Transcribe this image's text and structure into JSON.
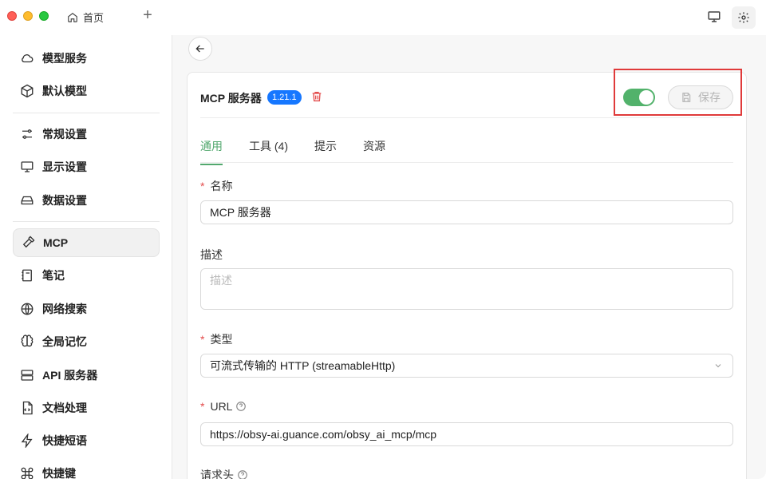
{
  "titlebar": {
    "home_tab": "首页",
    "new_tab": "+"
  },
  "sidebar": {
    "items": [
      {
        "label": "模型服务",
        "icon": "cloud-icon"
      },
      {
        "label": "默认模型",
        "icon": "cube-icon"
      },
      {
        "label": "常规设置",
        "icon": "sliders-icon"
      },
      {
        "label": "显示设置",
        "icon": "display-settings-icon"
      },
      {
        "label": "数据设置",
        "icon": "hard-drive-icon"
      },
      {
        "label": "MCP",
        "icon": "hammer-icon",
        "active": true
      },
      {
        "label": "笔记",
        "icon": "notebook-icon"
      },
      {
        "label": "网络搜索",
        "icon": "globe-icon"
      },
      {
        "label": "全局记忆",
        "icon": "brain-icon"
      },
      {
        "label": "API 服务器",
        "icon": "server-icon"
      },
      {
        "label": "文档处理",
        "icon": "file-code-icon"
      },
      {
        "label": "快捷短语",
        "icon": "zap-icon"
      },
      {
        "label": "快捷键",
        "icon": "command-icon"
      }
    ]
  },
  "server": {
    "title": "MCP 服务器",
    "version": "1.21.1",
    "enabled": true,
    "save_label": "保存"
  },
  "tabs": [
    "通用",
    "工具 (4)",
    "提示",
    "资源"
  ],
  "form": {
    "name_label": "名称",
    "name_value": "MCP 服务器",
    "desc_label": "描述",
    "desc_placeholder": "描述",
    "type_label": "类型",
    "type_value": "可流式传输的 HTTP (streamableHttp)",
    "url_label": "URL",
    "url_value": "https://obsy-ai.guance.com/obsy_ai_mcp/mcp",
    "headers_label": "请求头"
  },
  "colors": {
    "accent": "#52a86e",
    "toggle_on": "#52b26b",
    "version_badge": "#1677ff",
    "required": "#e34d4d",
    "highlight": "#e03a3a"
  }
}
